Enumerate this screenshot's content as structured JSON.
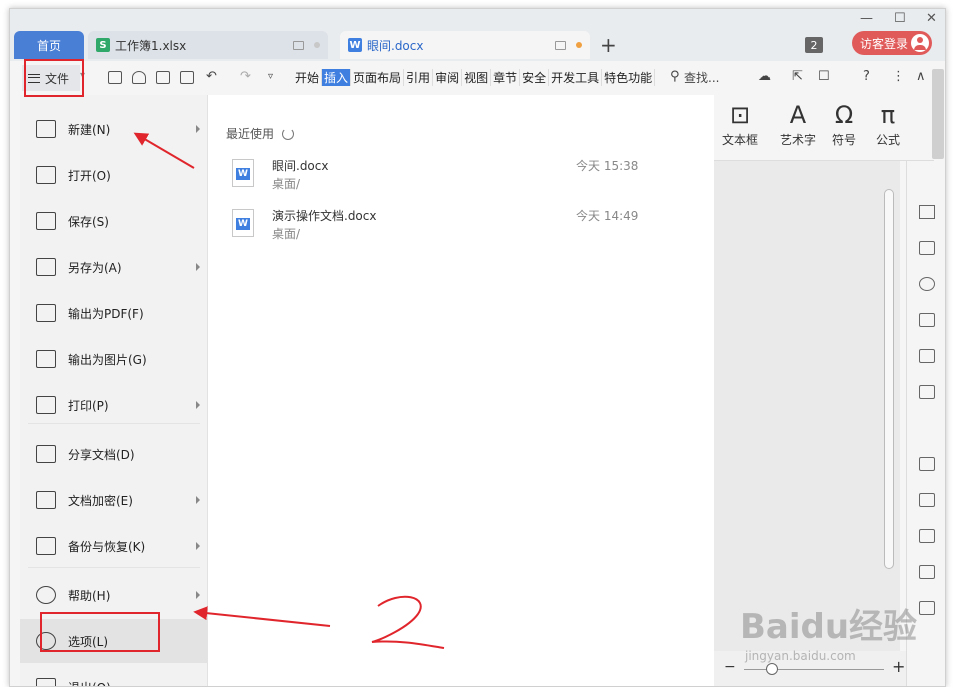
{
  "tabs": {
    "home": "首页",
    "items": [
      {
        "label": "工作簿1.xlsx",
        "type": "S",
        "dot_color": "#c8c8c8"
      },
      {
        "label": "眼间.docx",
        "type": "W",
        "dot_color": "#f0a040"
      }
    ],
    "badge_count": "2",
    "login": "访客登录"
  },
  "toolbar": {
    "file_label": "文件",
    "menu_tabs": [
      "开始",
      "插入",
      "页面布局",
      "引用",
      "审阅",
      "视图",
      "章节",
      "安全",
      "开发工具",
      "特色功能"
    ],
    "active_tab_index": 1,
    "search": "查找..."
  },
  "ribbon": {
    "items": [
      "文本框",
      "艺术字",
      "符号",
      "公式"
    ]
  },
  "file_menu": {
    "items": [
      {
        "label": "新建(N)",
        "arrow": true
      },
      {
        "label": "打开(O)",
        "arrow": false
      },
      {
        "label": "保存(S)",
        "arrow": false
      },
      {
        "label": "另存为(A)",
        "arrow": true
      },
      {
        "label": "输出为PDF(F)",
        "arrow": false
      },
      {
        "label": "输出为图片(G)",
        "arrow": false
      },
      {
        "label": "打印(P)",
        "arrow": true
      },
      {
        "label": "分享文档(D)",
        "arrow": false
      },
      {
        "label": "文档加密(E)",
        "arrow": true
      },
      {
        "label": "备份与恢复(K)",
        "arrow": true
      },
      {
        "label": "帮助(H)",
        "arrow": true
      },
      {
        "label": "选项(L)",
        "arrow": false
      },
      {
        "label": "退出(Q)",
        "arrow": false
      }
    ],
    "highlight_index": 11
  },
  "recent": {
    "title": "最近使用",
    "files": [
      {
        "name": "眼间.docx",
        "path": "桌面/",
        "time": "今天 15:38"
      },
      {
        "name": "演示操作文档.docx",
        "path": "桌面/",
        "time": "今天 14:49"
      }
    ]
  },
  "annotation": {
    "step_number": "2",
    "color": "#e0262c"
  },
  "watermark": {
    "text": "Baidu经验",
    "sub": "jingyan.baidu.com"
  }
}
